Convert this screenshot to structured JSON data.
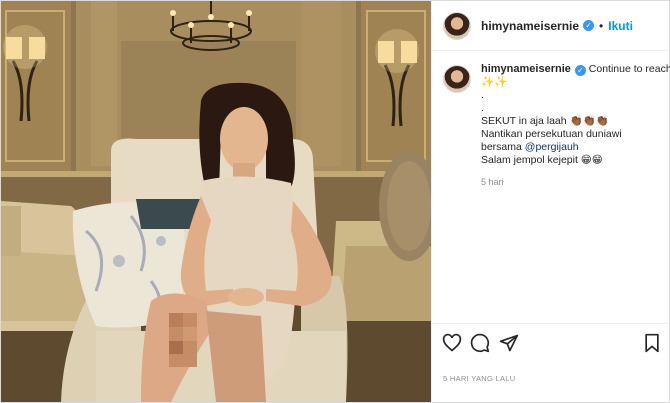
{
  "post": {
    "username": "himynameisernie",
    "follow_label": "Ikuti",
    "separator": "•",
    "caption": {
      "title_text": "Continue to reach out",
      "title_emoji": "✨✨",
      "dot_line_1": ".",
      "dot_line_2": ".",
      "line_1": "SEKUT in aja laah 👏🏾👏🏾👏🏾",
      "line_2": "Nantikan persekutuan duniawi",
      "line_3_prefix": "bersama ",
      "mention": "@pergijauh",
      "line_4": "Salam jempol kejepit 😁😁",
      "time": "5 hari"
    },
    "date_label": "5 HARI YANG LALU"
  },
  "icons": {
    "verified": "verified-badge-icon",
    "like": "heart-icon",
    "comment": "comment-icon",
    "share": "send-icon",
    "save": "bookmark-icon"
  },
  "colors": {
    "link": "#0095f6",
    "mention": "#00376b",
    "verified": "#3897f0",
    "muted": "#8e8e8e"
  }
}
